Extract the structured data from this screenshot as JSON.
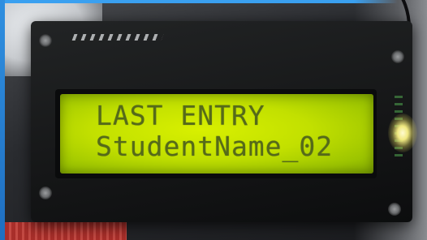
{
  "lcd": {
    "line1": "LAST ENTRY",
    "line2": "StudentName_02",
    "text_color": "#556a1a",
    "backlight_color": "#c2e000"
  },
  "scene": {
    "frame_color": "#2f8fe0",
    "pcb_color": "#151617"
  }
}
